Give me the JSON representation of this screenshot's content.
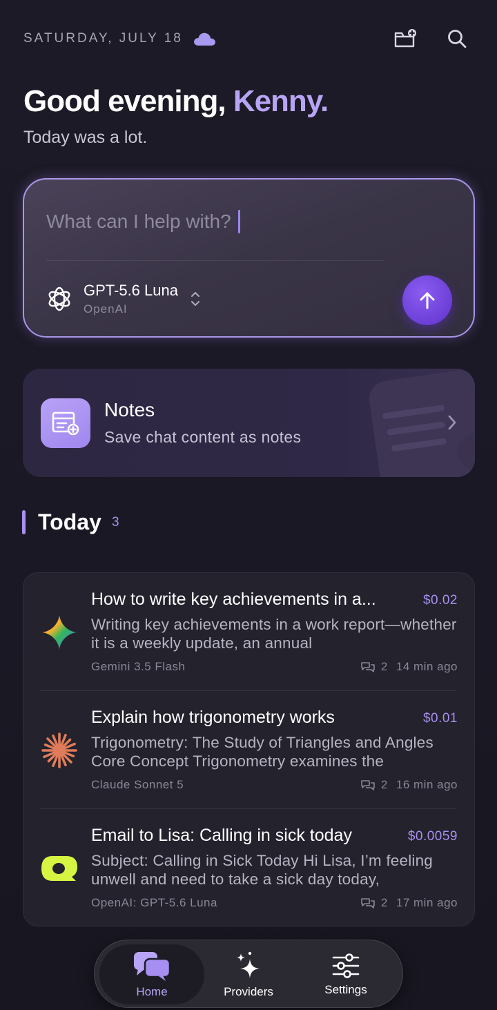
{
  "header": {
    "date": "SATURDAY, JULY 18",
    "weather_icon": "cloud-icon",
    "actions": [
      "new-folder-icon",
      "search-icon"
    ]
  },
  "greeting": {
    "prefix": "Good evening,",
    "name": "Kenny.",
    "subtitle": "Today was a lot."
  },
  "composer": {
    "placeholder": "What can I help with?",
    "model_name": "GPT-5.6 Luna",
    "provider": "OpenAI",
    "accent": "#a995e8"
  },
  "notes_card": {
    "title": "Notes",
    "description": "Save chat content as notes"
  },
  "today": {
    "title": "Today",
    "count": "3"
  },
  "chats": [
    {
      "title": "How to write key achievements in a...",
      "price": "$0.02",
      "snippet": "Writing key achievements in a work report—whether it is a weekly update, an annual",
      "model": "Gemini 3.5 Flash",
      "messages": "2",
      "time": "14 min ago",
      "icon": "gemini-icon"
    },
    {
      "title": "Explain how trigonometry works",
      "price": "$0.01",
      "snippet": "Trigonometry: The Study of Triangles and Angles Core Concept Trigonometry examines the",
      "model": "Claude Sonnet 5",
      "messages": "2",
      "time": "16 min ago",
      "icon": "claude-icon"
    },
    {
      "title": "Email to Lisa: Calling in sick today",
      "price": "$0.0059",
      "snippet": "Subject: Calling in Sick Today Hi Lisa, I’m feeling unwell and need to take a sick day today,",
      "model": "OpenAI: GPT-5.6 Luna",
      "messages": "2",
      "time": "17 min ago",
      "icon": "luna-icon"
    }
  ],
  "nav": {
    "items": [
      {
        "label": "Home",
        "icon": "chat-bubbles-icon",
        "active": true
      },
      {
        "label": "Providers",
        "icon": "sparkles-icon",
        "active": false
      },
      {
        "label": "Settings",
        "icon": "sliders-icon",
        "active": false
      }
    ]
  }
}
